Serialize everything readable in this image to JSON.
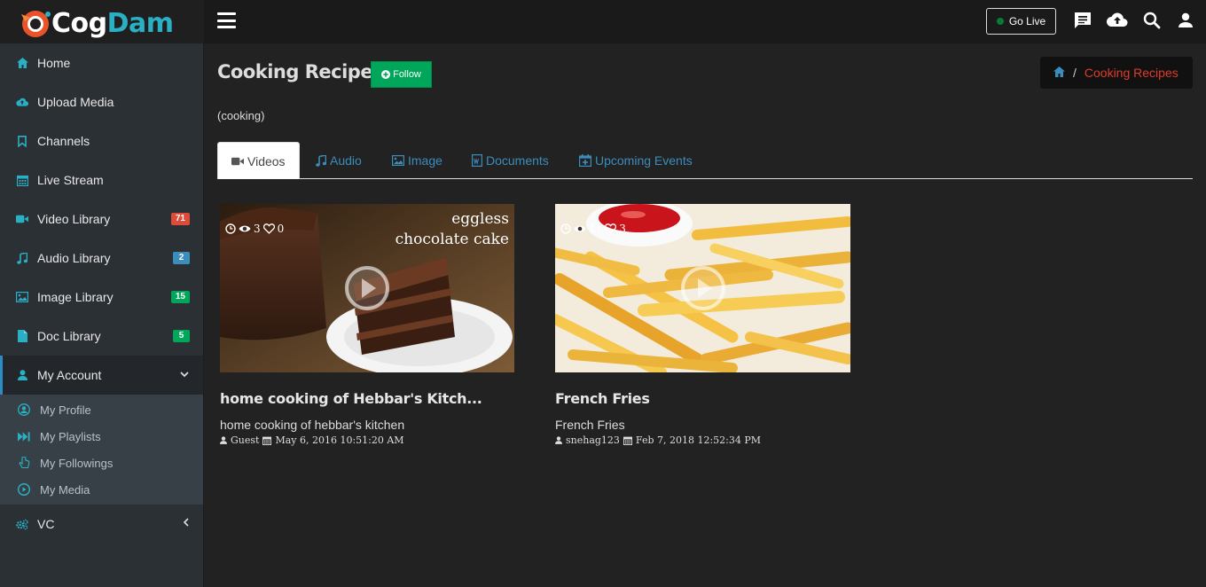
{
  "brand": {
    "part1": "Cog",
    "part2": "Dam"
  },
  "topbar": {
    "go_live": "Go Live"
  },
  "sidebar": {
    "items": [
      {
        "label": "Home"
      },
      {
        "label": "Upload Media"
      },
      {
        "label": "Channels"
      },
      {
        "label": "Live Stream"
      },
      {
        "label": "Video Library",
        "badge": "71",
        "badge_color": "#dd4b39"
      },
      {
        "label": "Audio Library",
        "badge": "2",
        "badge_color": "#3c8dbc"
      },
      {
        "label": "Image Library",
        "badge": "15",
        "badge_color": "#00a65a"
      },
      {
        "label": "Doc Library",
        "badge": "5",
        "badge_color": "#00a65a"
      },
      {
        "label": "My Account"
      }
    ],
    "account_sub": [
      {
        "label": "My Profile"
      },
      {
        "label": "My Playlists"
      },
      {
        "label": "My Followings"
      },
      {
        "label": "My Media"
      }
    ],
    "vc": {
      "label": "VC"
    }
  },
  "page": {
    "title": "Cooking Recipes",
    "follow": "Follow",
    "subtitle": "(cooking)",
    "breadcrumb_sep": "/",
    "breadcrumb_current": "Cooking Recipes"
  },
  "tabs": [
    {
      "label": "Videos"
    },
    {
      "label": "Audio"
    },
    {
      "label": "Image"
    },
    {
      "label": "Documents"
    },
    {
      "label": "Upcoming Events"
    }
  ],
  "videos": [
    {
      "views": "3",
      "likes": "0",
      "overlay_line1": "eggless",
      "overlay_line2": "chocolate cake",
      "title": "home cooking of Hebbar's Kitch...",
      "description": "home cooking of hebbar's kitchen",
      "user": "Guest",
      "date": "May 6, 2016 10:51:20 AM"
    },
    {
      "views": "11",
      "likes": "3",
      "title": "French Fries",
      "description": "French Fries",
      "user": "snehag123",
      "date": "Feb 7, 2018 12:52:34 PM"
    }
  ],
  "colors": {
    "accent": "#3c8dbc",
    "follow_green": "#00a65a",
    "breadcrumb_active": "#e03b2a",
    "sidebar_icon": "#2ab0c5"
  }
}
